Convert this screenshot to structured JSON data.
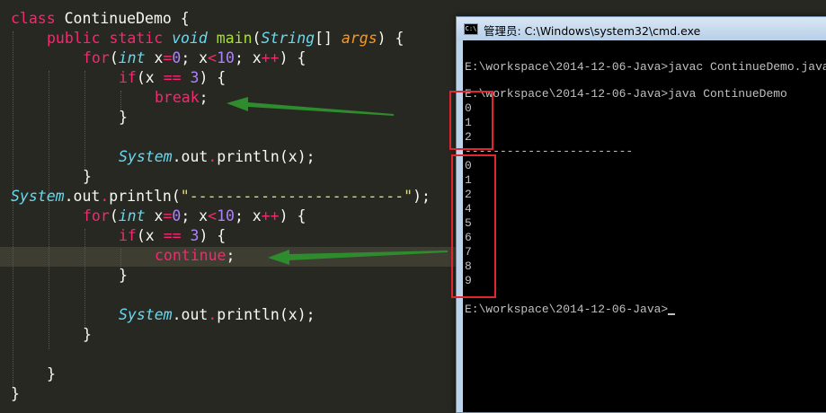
{
  "editor": {
    "lines": [
      {
        "kind": "class",
        "kw": "class",
        "name": " ContinueDemo {"
      },
      {
        "kind": "method",
        "p1": "public",
        "p2": "static",
        "ret": "void",
        "fn": "main",
        "t": "String",
        "rest1": "[] ",
        "arg": "args",
        "rest2": ") {"
      },
      {
        "kind": "for",
        "kw": "for",
        "ty": "int",
        "v": " x",
        "eq": "=",
        "n0": "0",
        "s1": "; x",
        "lt": "<",
        "n1": "10",
        "s2": "; x",
        "pp": "++",
        "end": ") {"
      },
      {
        "kind": "if",
        "kw": "if",
        "open": "(x ",
        "eq": "==",
        "sp": " ",
        "n": "3",
        "end": ") {"
      },
      {
        "kind": "stmt",
        "kw": "break",
        "end": ";"
      },
      {
        "kind": "brace",
        "text": "}"
      },
      {
        "kind": "print",
        "cls": "System",
        "dot": ".",
        "out": "out",
        "dot2": ".",
        "call": "println(x);"
      },
      {
        "kind": "brace",
        "text": "}"
      },
      {
        "kind": "printstr",
        "cls": "System",
        "dot": ".",
        "out": "out",
        "dot2": ".",
        "call": "println(",
        "str": "\"------------------------\"",
        "end": ");"
      },
      {
        "kind": "for",
        "kw": "for",
        "ty": "int",
        "v": " x",
        "eq": "=",
        "n0": "0",
        "s1": "; x",
        "lt": "<",
        "n1": "10",
        "s2": "; x",
        "pp": "++",
        "end": ") {"
      },
      {
        "kind": "if",
        "kw": "if",
        "open": "(x ",
        "eq": "==",
        "sp": " ",
        "n": "3",
        "end": ") {"
      },
      {
        "kind": "stmt",
        "kw": "continue",
        "end": ";"
      },
      {
        "kind": "brace",
        "text": "}"
      },
      {
        "kind": "print",
        "cls": "System",
        "dot": ".",
        "out": "out",
        "dot2": ".",
        "call": "println(x);"
      },
      {
        "kind": "brace",
        "text": "}"
      },
      {
        "kind": "brace",
        "text": "}"
      },
      {
        "kind": "brace",
        "text": "}"
      }
    ]
  },
  "cmd": {
    "title": "管理员: C:\\Windows\\system32\\cmd.exe",
    "icon_label": "C:\\",
    "lines": [
      "E:\\workspace\\2014-12-06-Java>javac ContinueDemo.java",
      "E:\\workspace\\2014-12-06-Java>java ContinueDemo",
      "0",
      "1",
      "2",
      "------------------------",
      "0",
      "1",
      "2",
      "4",
      "5",
      "6",
      "7",
      "8",
      "9",
      "E:\\workspace\\2014-12-06-Java>"
    ]
  },
  "colors": {
    "editor_bg": "#272822",
    "keyword": "#f92672",
    "type": "#66d9ef",
    "function": "#a6e22e",
    "number": "#ae81ff",
    "string": "#e6db74",
    "annotation_red": "#e0262e",
    "arrow_green": "#2e8b2e"
  }
}
